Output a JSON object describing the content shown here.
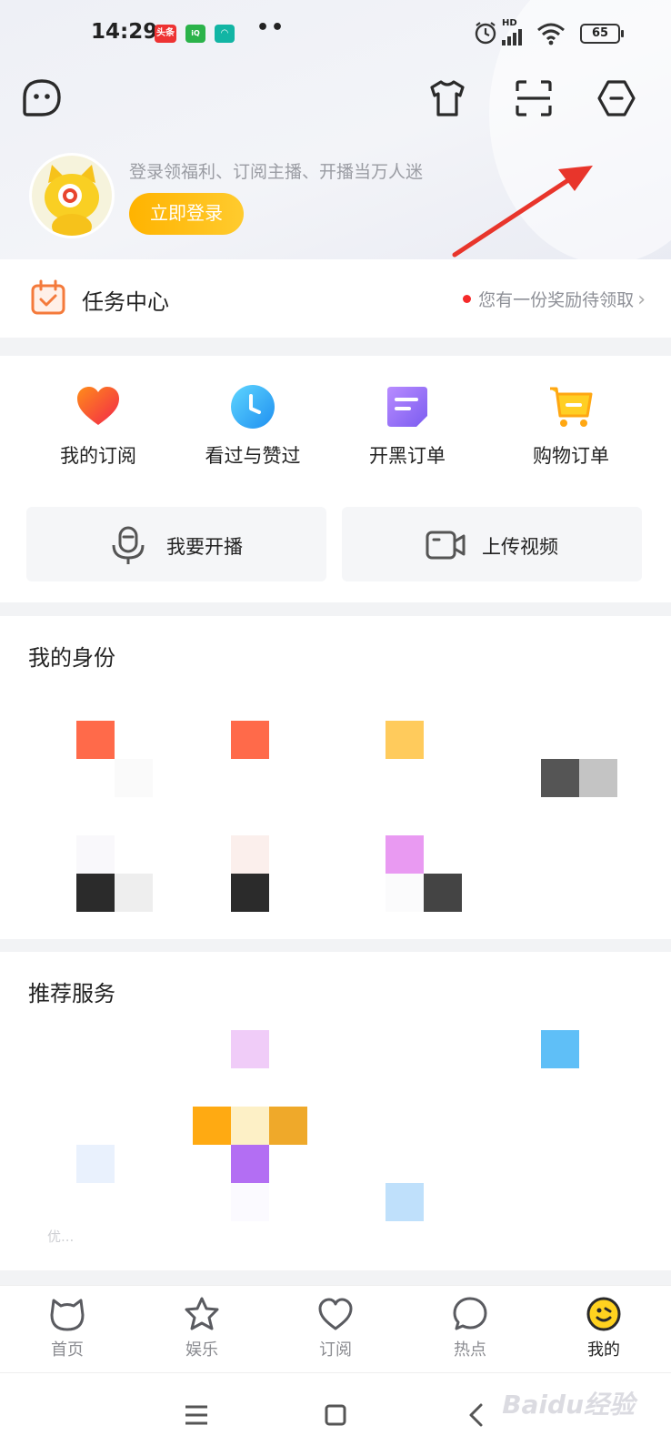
{
  "status_bar": {
    "time": "14:29",
    "badges": [
      "头条",
      "爱奇艺",
      "app"
    ],
    "dots": "••",
    "battery": "65",
    "network": "HD"
  },
  "header": {
    "left_icon": "chat-bubble-icon",
    "right_icons": [
      "shirt-icon",
      "scan-icon",
      "settings-hexagon-icon"
    ]
  },
  "profile": {
    "hint": "登录领福利、订阅主播、开播当万人迷",
    "login_label": "立即登录"
  },
  "task_center": {
    "title": "任务中心",
    "reward_text": "您有一份奖励待领取",
    "chevron": "›"
  },
  "shortcuts": [
    {
      "label": "我的订阅",
      "icon": "heart-icon"
    },
    {
      "label": "看过与赞过",
      "icon": "clock-icon"
    },
    {
      "label": "开黑订单",
      "icon": "note-icon"
    },
    {
      "label": "购物订单",
      "icon": "cart-icon"
    }
  ],
  "actions": [
    {
      "label": "我要开播",
      "icon": "microphone-icon"
    },
    {
      "label": "上传视频",
      "icon": "video-camera-icon"
    }
  ],
  "identity": {
    "title": "我的身份"
  },
  "services": {
    "title": "推荐服务",
    "faded_text": "优..."
  },
  "tabbar": [
    {
      "label": "首页",
      "icon": "cat-head-icon"
    },
    {
      "label": "娱乐",
      "icon": "star-icon"
    },
    {
      "label": "订阅",
      "icon": "heart-outline-icon"
    },
    {
      "label": "热点",
      "icon": "chat-icon"
    },
    {
      "label": "我的",
      "icon": "face-icon",
      "active": true
    }
  ],
  "watermark": "Baidu经验",
  "colors": {
    "accent": "#ffb300",
    "annotation_arrow": "#e8352b",
    "reward_dot": "#f52a2a"
  }
}
